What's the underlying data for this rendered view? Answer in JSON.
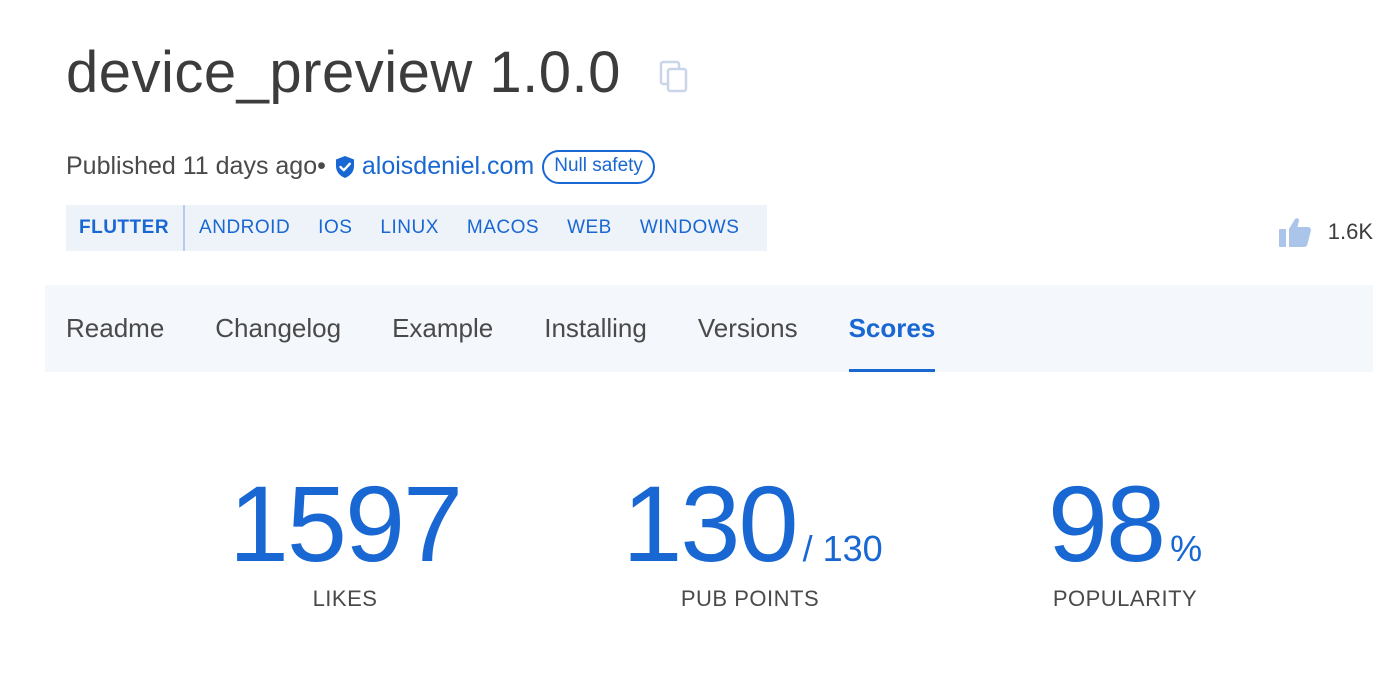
{
  "package": {
    "title": "device_preview 1.0.0"
  },
  "meta": {
    "published": "Published 11 days ago",
    "separator": "•",
    "publisher": "aloisdeniel.com",
    "badge": "Null safety"
  },
  "platforms": {
    "sdk": "FLUTTER",
    "items": [
      "ANDROID",
      "IOS",
      "LINUX",
      "MACOS",
      "WEB",
      "WINDOWS"
    ]
  },
  "likes": {
    "count": "1.6K"
  },
  "tabs": [
    "Readme",
    "Changelog",
    "Example",
    "Installing",
    "Versions",
    "Scores"
  ],
  "active_tab": "Scores",
  "scores": {
    "likes": {
      "value": "1597",
      "label": "LIKES"
    },
    "pub_points": {
      "value": "130",
      "max": "/ 130",
      "label": "PUB POINTS"
    },
    "popularity": {
      "value": "98",
      "unit": "%",
      "label": "POPULARITY"
    }
  },
  "icons": {
    "copy": "copy-icon",
    "verified": "verified-publisher-icon",
    "like": "thumb-up-icon"
  },
  "colors": {
    "accent": "#1967d2",
    "text": "#4a4a4a",
    "title": "#3c3c3c",
    "platform_bg": "#eef3fa",
    "tabs_bg": "#f4f7fb"
  }
}
